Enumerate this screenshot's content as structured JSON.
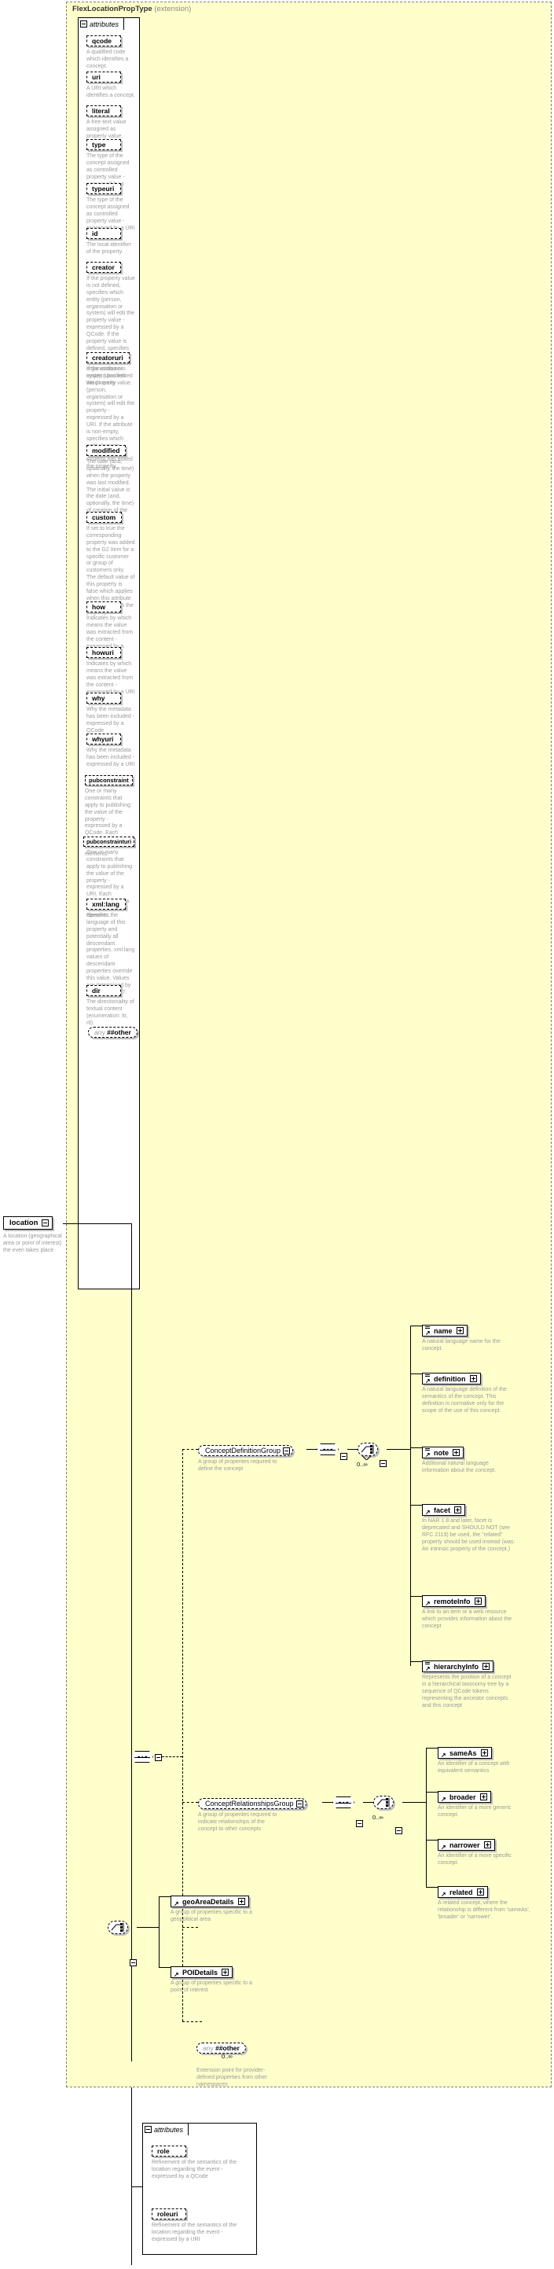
{
  "diagram": {
    "type_title": "FlexLocationPropType",
    "type_kind": "(extension)",
    "attributes_label": "attributes"
  },
  "location_element": {
    "name": "location",
    "description": "A location (geographical area or point of interest) the even takes place"
  },
  "top_attributes": [
    {
      "name": "qcode",
      "description": "A qualified code which identifies a concept."
    },
    {
      "name": "uri",
      "description": "A URI which identifies a concept."
    },
    {
      "name": "literal",
      "description": "A free-text value assigned as property value."
    },
    {
      "name": "type",
      "description": "The type of the concept assigned as controlled property value - expressed by a QCode"
    },
    {
      "name": "typeuri",
      "description": "The type of the concept assigned as controlled property value - expressed by a URI"
    },
    {
      "name": "id",
      "description": "The local identifier of the property."
    },
    {
      "name": "creator",
      "description": "If the property value is not defined, specifies which entity (person, organisation or system) will edit the property value - expressed by a QCode. If the property value is defined, specifies which entity (person, organisation or system) has edited the property value."
    },
    {
      "name": "creatoruri",
      "description": "If the attribute is empty, specifies which entity (person, organisation or system) will edit the property - expressed by a URI. If the attribute is non-empty, specifies which entity (person, organisation or system) has edited the property."
    },
    {
      "name": "modified",
      "description": "The date (and, optionally, the time) when the property was last modified. The initial value is the date (and, optionally, the time) of creation of the property."
    },
    {
      "name": "custom",
      "description": "If set to true the corresponding property was added to the G2 Item for a specific customer or group of customers only. The default value of this property is false which applies when this attribute is not used with the property."
    },
    {
      "name": "how",
      "description": "Indicates by which means the value was extracted from the content - expressed by a QCode"
    },
    {
      "name": "howuri",
      "description": "Indicates by which means the value was extracted from the content - expressed by a URI"
    },
    {
      "name": "why",
      "description": "Why the metadata has been included - expressed by a QCode"
    },
    {
      "name": "whyuri",
      "description": "Why the metadata has been included - expressed by a URI"
    },
    {
      "name": "pubconstraint",
      "description": "One or many constraints that apply to publishing the value of the property - expressed by a QCode. Each constraint applies to all descendant elements."
    },
    {
      "name": "pubconstrainturi",
      "description": "One or many constraints that apply to publishing the value of the property - expressed by a URI. Each constraint applies to all descendant elements."
    },
    {
      "name": "xml:lang",
      "description": "Specifies the language of this property and potentially all descendant properties. xml:lang values of descendant properties override this value. Values are determined by Internet BCP 47."
    },
    {
      "name": "dir",
      "description": "The directionality of textual content (enumeration: ltr, rtl)"
    }
  ],
  "top_any": {
    "word": "any",
    "namespace": "##other"
  },
  "groups": [
    {
      "name": "ConceptDefinitionGroup",
      "description": "A group of properites required to define the concept",
      "occurs": "0..∞"
    },
    {
      "name": "ConceptRelationshipsGroup",
      "description": "A group of properites required to indicate relationships of the concept to other concepts",
      "occurs": "0..∞"
    }
  ],
  "definition_elements": [
    {
      "name": "name",
      "description": "A natural language name for the concept.",
      "has_seq_glyph": true
    },
    {
      "name": "definition",
      "description": "A natural language definition of the semantics of the concept. This definition is normative only for the scope of the use of this concept.",
      "has_seq_glyph": true
    },
    {
      "name": "note",
      "description": "Additional natural language information about the concept.",
      "has_seq_glyph": true
    },
    {
      "name": "facet",
      "description": "In NAR 1.8 and later, facet is deprecated and SHOULD NOT (see RFC 2119) be used, the \"related\" property should be used instead (was: An intrinsic property of the concept.)",
      "has_seq_glyph": false
    },
    {
      "name": "remoteInfo",
      "description": "A link to an item or a web resource which provides information about the concept",
      "has_seq_glyph": false
    },
    {
      "name": "hierarchyInfo",
      "description": "Represents the position of a concept in a hierarchical taxonomy tree by a sequence of QCode tokens representing the ancestor concepts and this concept",
      "has_seq_glyph": true
    }
  ],
  "relationship_elements": [
    {
      "name": "sameAs",
      "description": "An identifier of a concept with equivalent semantics"
    },
    {
      "name": "broader",
      "description": "An identifier of a more generic concept."
    },
    {
      "name": "narrower",
      "description": "An identifier of a more specific concept."
    },
    {
      "name": "related",
      "description": "A related concept, where the relationship is different from 'sameAs', 'broader' or 'narrower'."
    }
  ],
  "detail_elements": [
    {
      "name": "geoAreaDetails",
      "description": "A group of properties specific to a geopolitical area"
    },
    {
      "name": "POIDetails",
      "description": "A group of properties specific to a point of interest"
    }
  ],
  "bottom_any": {
    "word": "any",
    "namespace": "##other",
    "occurs": "0..∞",
    "description": "Extension point for provider-defined properties from other namespaces"
  },
  "bottom_attributes": [
    {
      "name": "role",
      "description": "Refinement of the semantics of the location regarding the event - expressed by a QCode"
    },
    {
      "name": "roleuri",
      "description": "Refinement of the semantics of the location regarding the event - expressed by a URI"
    }
  ],
  "colors": {
    "extension_background": "#ffffcc",
    "panel_background": "#ffffff",
    "description_text": "#999999",
    "border": "#000000"
  }
}
